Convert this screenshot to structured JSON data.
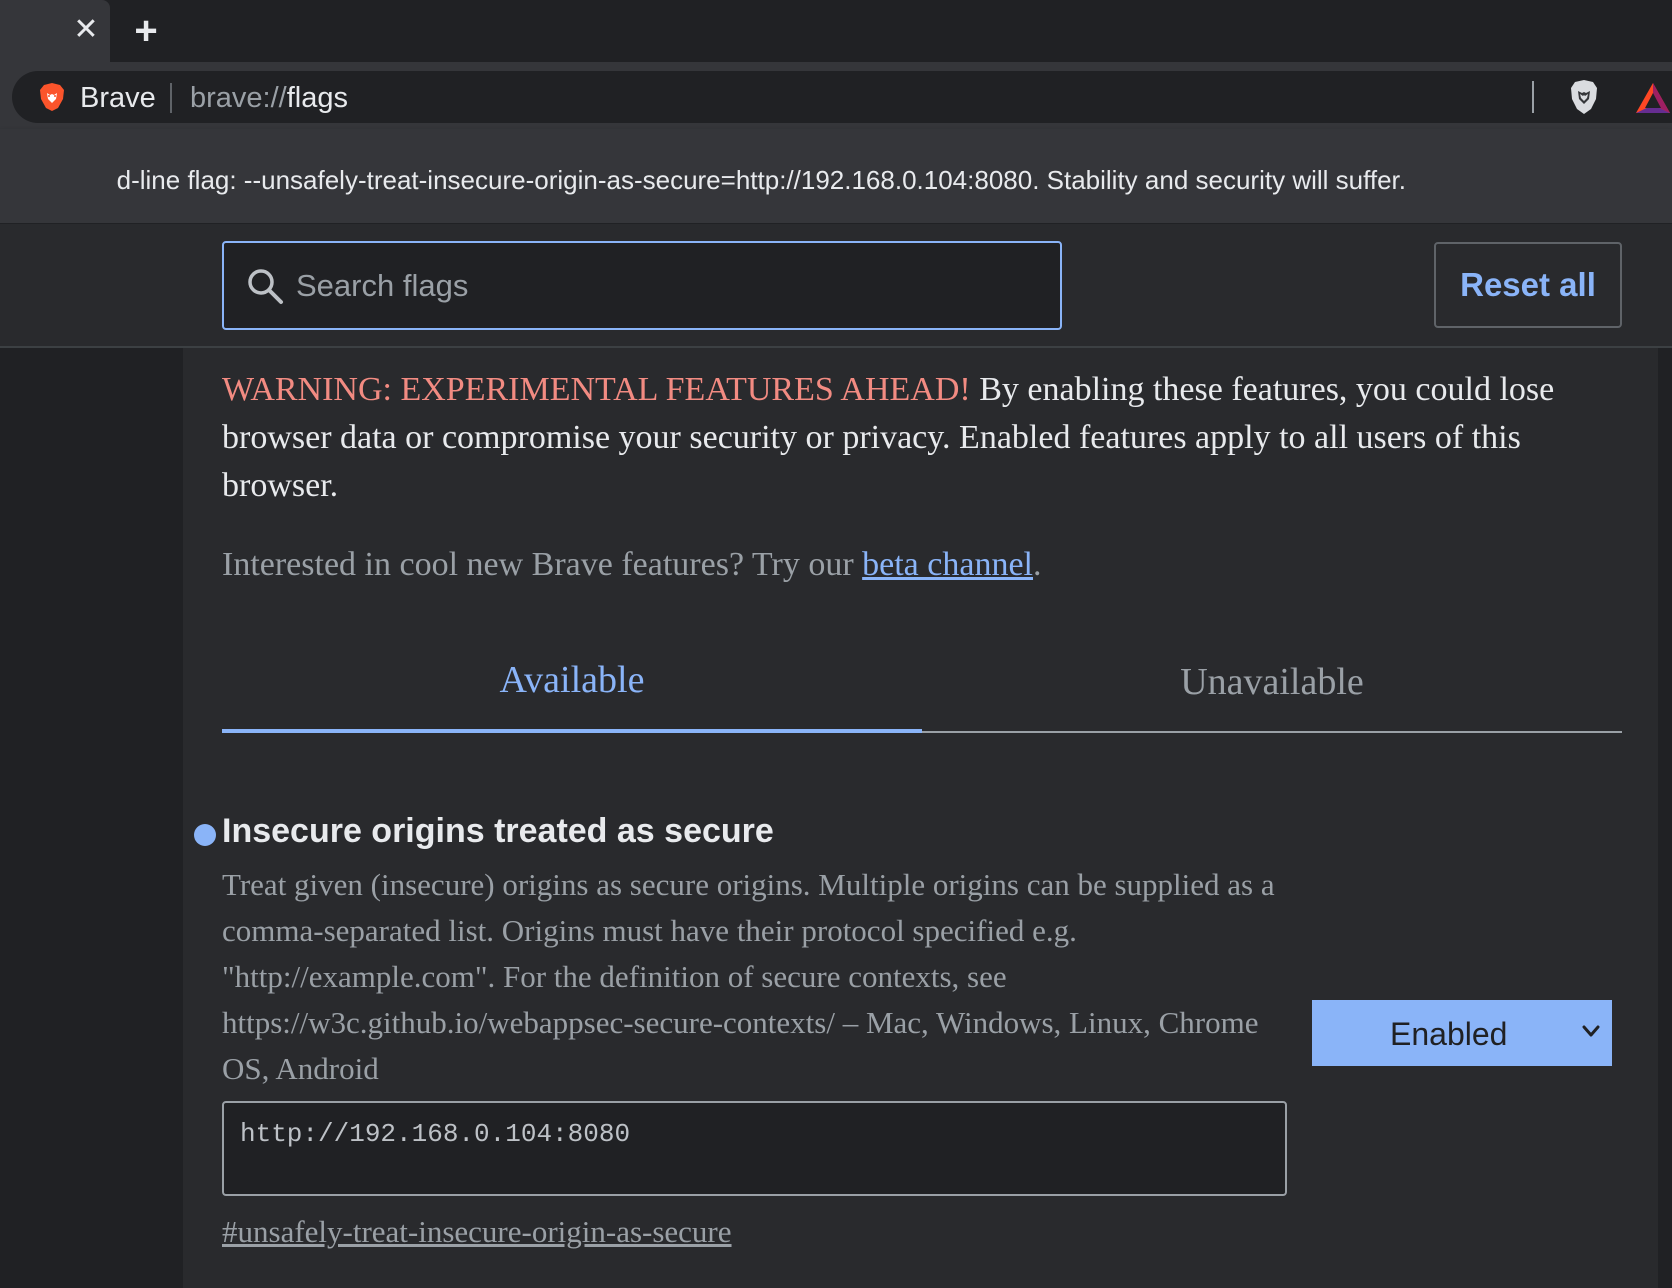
{
  "tabstrip": {
    "close_icon": "close-icon",
    "new_tab_icon": "plus-icon"
  },
  "omnibox": {
    "site_name": "Brave",
    "url_scheme": "brave://",
    "url_path": "flags"
  },
  "infobar": {
    "text": "d-line flag: --unsafely-treat-insecure-origin-as-secure=http://192.168.0.104:8080. Stability and security will suffer."
  },
  "header": {
    "search_placeholder": "Search flags",
    "reset_label": "Reset all"
  },
  "warning": {
    "title": "WARNING: EXPERIMENTAL FEATURES AHEAD!",
    "body": " By enabling these features, you could lose browser data or compromise your security or privacy. Enabled features apply to all users of this browser."
  },
  "beta": {
    "prefix": "Interested in cool new Brave features? Try our ",
    "link": "beta channel",
    "suffix": "."
  },
  "tabs": {
    "available": "Available",
    "unavailable": "Unavailable"
  },
  "experiment": {
    "title": "Insecure origins treated as secure",
    "description": "Treat given (insecure) origins as secure origins. Multiple origins can be supplied as a comma-separated list. Origins must have their protocol specified e.g. \"http://example.com\". For the definition of secure contexts, see https://w3c.github.io/webappsec-secure-contexts/ – Mac, Windows, Linux, Chrome OS, Android",
    "value": "http://192.168.0.104:8080",
    "link": "#unsafely-treat-insecure-origin-as-secure",
    "select_value": "Enabled"
  },
  "colors": {
    "accent": "#8ab4f8",
    "warning": "#f28b82",
    "background": "#292a2d",
    "brave_orange": "#fb542b"
  }
}
